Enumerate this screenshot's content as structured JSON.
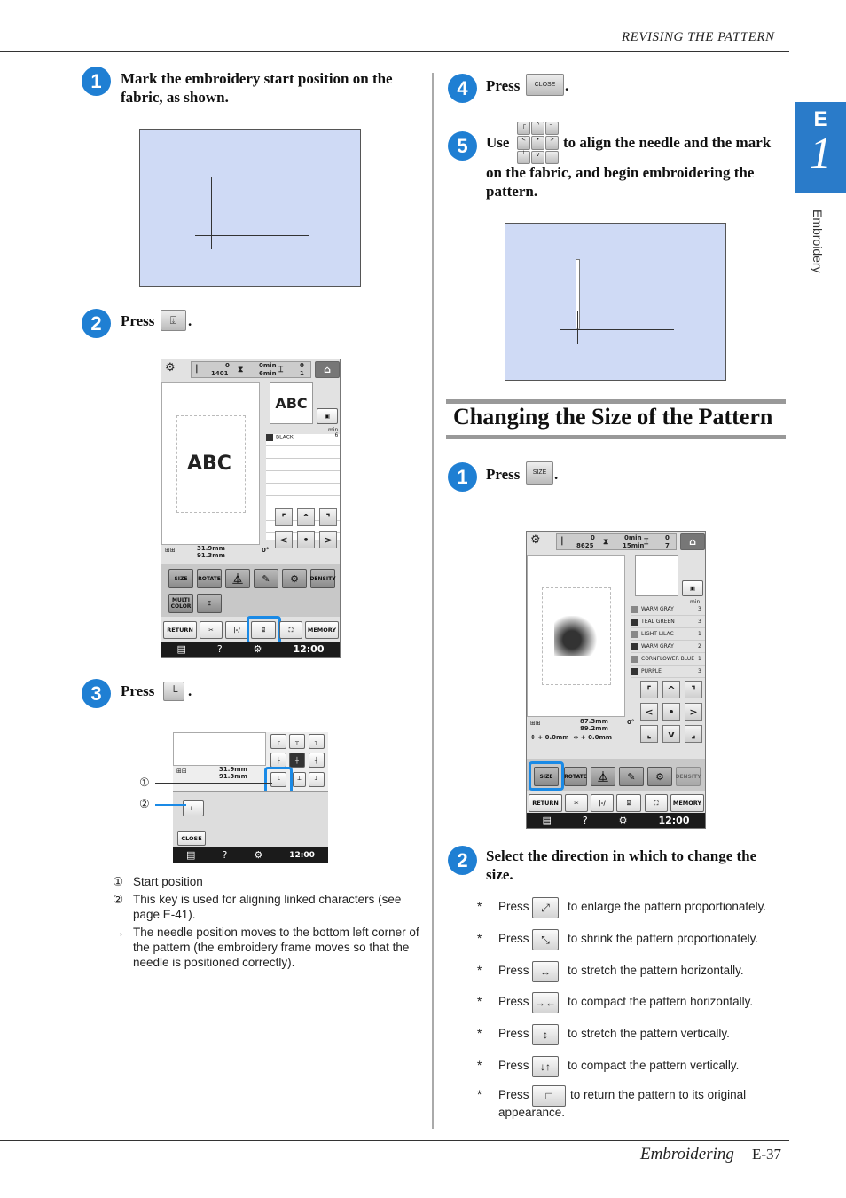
{
  "header": {
    "section": "REVISING THE PATTERN"
  },
  "tab": {
    "letter": "E",
    "number": "1",
    "label": "Embroidery",
    "color": "#2a7bc9"
  },
  "accent": "#1f7fd3",
  "left": {
    "step1": {
      "num": "1",
      "text1": "Mark the embroidery start position on the",
      "text2": "fabric, as shown."
    },
    "step2": {
      "num": "2",
      "press": "Press",
      "end": "."
    },
    "step3": {
      "num": "3",
      "press": "Press",
      "end": "."
    },
    "lcd1": {
      "count_top": "0",
      "count_bot": "1401",
      "time_top": "0min",
      "time_bot": "6min",
      "color_top": "0",
      "color_bot": "1",
      "preview": "ABC",
      "thumb": "ABC",
      "thread": "BLACK",
      "min_label": "min",
      "min_val": "6",
      "width": "31.9mm",
      "height": "91.3mm",
      "angle": "0°",
      "buttons": [
        "SIZE",
        "ROTATE",
        "DENSITY",
        "MULTI COLOR",
        "RETURN",
        "MEMORY"
      ],
      "clock": "12:00",
      "help": "?"
    },
    "lcd3": {
      "width": "31.9mm",
      "height": "91.3mm",
      "close": "CLOSE",
      "clock": "12:00",
      "help": "?"
    },
    "callouts": [
      "①",
      "②"
    ],
    "notes": [
      {
        "mark": "①",
        "text": "Start position"
      },
      {
        "mark": "②",
        "text": "This key is used for aligning linked characters (see page E-41)."
      },
      {
        "mark": "→",
        "text": "The needle position moves to the bottom left corner of the pattern (the embroidery frame moves so that the needle is positioned correctly)."
      }
    ]
  },
  "right": {
    "step4": {
      "num": "4",
      "press": "Press",
      "button": "CLOSE",
      "end": "."
    },
    "step5": {
      "num": "5",
      "use": "Use",
      "text1": "to align the needle and the mark",
      "text2": "on the fabric, and begin embroidering the",
      "text3": "pattern."
    },
    "section_title": "Changing the Size of the Pattern",
    "s1": {
      "num": "1",
      "press": "Press",
      "button": "SIZE",
      "end": "."
    },
    "s2": {
      "num": "2",
      "text1": "Select the direction in which to change the",
      "text2": "size."
    },
    "lcd2": {
      "count_top": "0",
      "count_bot": "8625",
      "time_top": "0min",
      "time_bot": "15min",
      "color_top": "0",
      "color_bot": "7",
      "threads": [
        {
          "name": "WARM GRAY",
          "min": "3"
        },
        {
          "name": "TEAL GREEN",
          "min": "3"
        },
        {
          "name": "LIGHT LILAC",
          "min": "1"
        },
        {
          "name": "WARM GRAY",
          "min": "2"
        },
        {
          "name": "CORNFLOWER BLUE",
          "min": "1"
        },
        {
          "name": "PURPLE",
          "min": "3"
        }
      ],
      "min_label": "min",
      "width": "87.3mm",
      "height": "89.2mm",
      "angle": "0°",
      "offset_v": "0.0mm",
      "offset_h": "0.0mm",
      "buttons": [
        "SIZE",
        "ROTATE",
        "DENSITY",
        "RETURN",
        "MEMORY"
      ],
      "clock": "12:00",
      "help": "?"
    },
    "bullets": [
      {
        "star": "*",
        "press": "Press",
        "icon": "enlarge-icon",
        "text": "to enlarge the pattern proportionately."
      },
      {
        "star": "*",
        "press": "Press",
        "icon": "shrink-icon",
        "text": "to shrink the pattern proportionately."
      },
      {
        "star": "*",
        "press": "Press",
        "icon": "stretch-horizontal-icon",
        "text": "to stretch the pattern horizontally."
      },
      {
        "star": "*",
        "press": "Press",
        "icon": "compact-horizontal-icon",
        "text": "to compact the pattern horizontally."
      },
      {
        "star": "*",
        "press": "Press",
        "icon": "stretch-vertical-icon",
        "text": "to stretch the pattern vertically."
      },
      {
        "star": "*",
        "press": "Press",
        "icon": "compact-vertical-icon",
        "text": "to compact the pattern vertically."
      },
      {
        "star": "*",
        "press": "Press",
        "icon": "reset-size-icon",
        "text": "to return the pattern to its original",
        "text2": "appearance."
      }
    ]
  },
  "footer": {
    "chapter": "Embroidering",
    "page": "E-37"
  }
}
